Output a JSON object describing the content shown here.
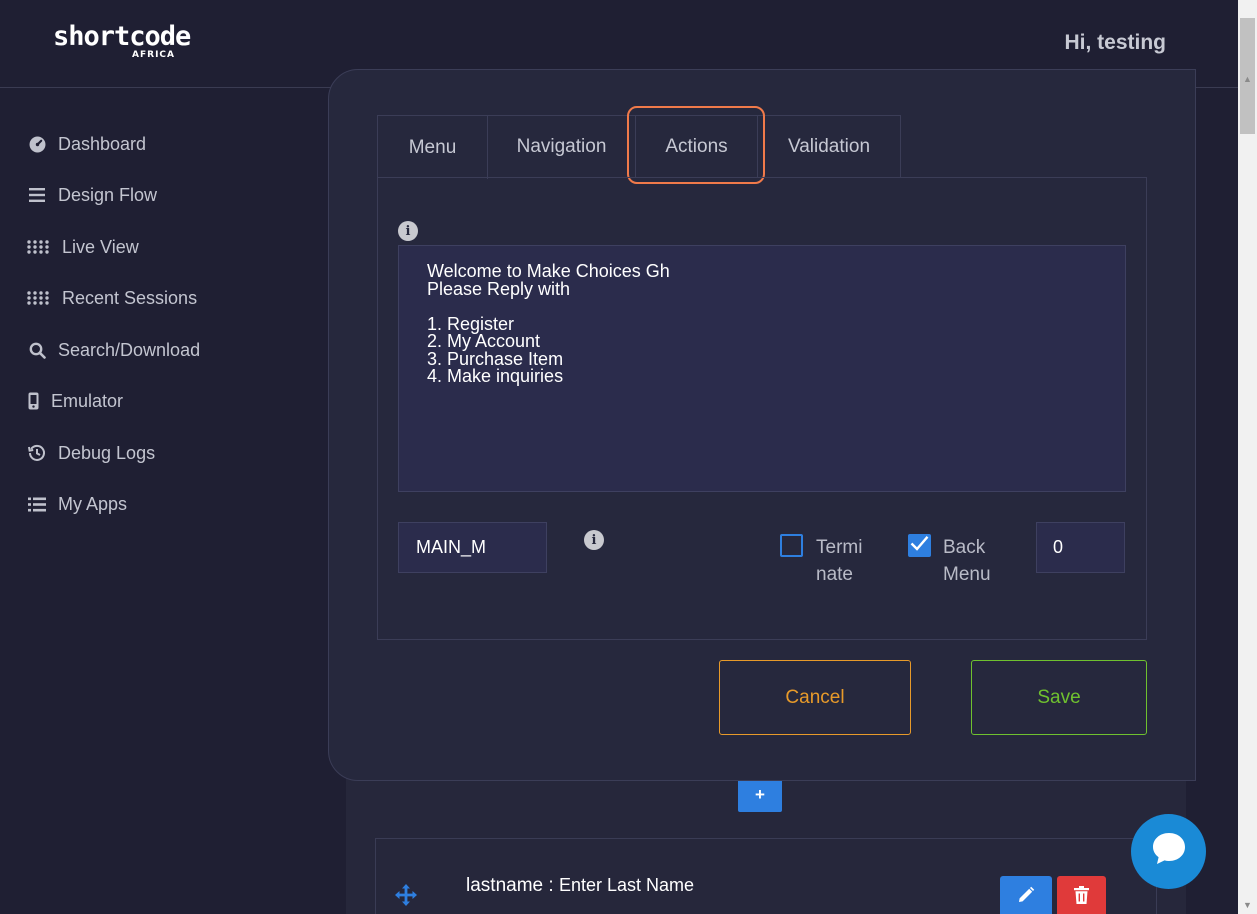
{
  "header": {
    "logo_main": "shortcode",
    "logo_sub": "AFRICA",
    "greeting": "Hi, testing"
  },
  "sidebar": {
    "items": [
      {
        "label": "Dashboard",
        "icon": "dashboard-gauge-icon"
      },
      {
        "label": "Design Flow",
        "icon": "bars-icon"
      },
      {
        "label": "Live View",
        "icon": "grid-dots-icon"
      },
      {
        "label": "Recent Sessions",
        "icon": "grid-dots-icon"
      },
      {
        "label": "Search/Download",
        "icon": "search-icon"
      },
      {
        "label": "Emulator",
        "icon": "mobile-phone-icon"
      },
      {
        "label": "Debug Logs",
        "icon": "history-icon"
      },
      {
        "label": "My Apps",
        "icon": "list-icon"
      }
    ]
  },
  "modal": {
    "tabs": [
      {
        "label": "Menu",
        "active": true
      },
      {
        "label": "Navigation",
        "active": false
      },
      {
        "label": "Actions",
        "active": false,
        "highlighted": true
      },
      {
        "label": "Validation",
        "active": false
      }
    ],
    "menu_text": "Welcome to Make Choices Gh\nPlease Reply with\n\n1. Register\n2. My Account\n3. Purchase Item\n4. Make inquiries",
    "menu_code": "MAIN_M",
    "terminate": {
      "label_line1": "Termi",
      "label_line2": "nate",
      "checked": false
    },
    "back_menu": {
      "label_line1": "Back",
      "label_line2": "Menu",
      "checked": true
    },
    "number_value": "0",
    "cancel_label": "Cancel",
    "save_label": "Save"
  },
  "background": {
    "add_label": "+",
    "row": {
      "key": "lastname",
      "separator": " : ",
      "prompt": "Enter Last Name"
    }
  },
  "colors": {
    "page_bg": "#1f1f33",
    "modal_bg": "#26283d",
    "accent_blue": "#2e7fe0",
    "cancel_orange": "#e79a2a",
    "save_green": "#6fc12f",
    "delete_red": "#e03a3a",
    "highlight_orange": "#f07a4a"
  }
}
